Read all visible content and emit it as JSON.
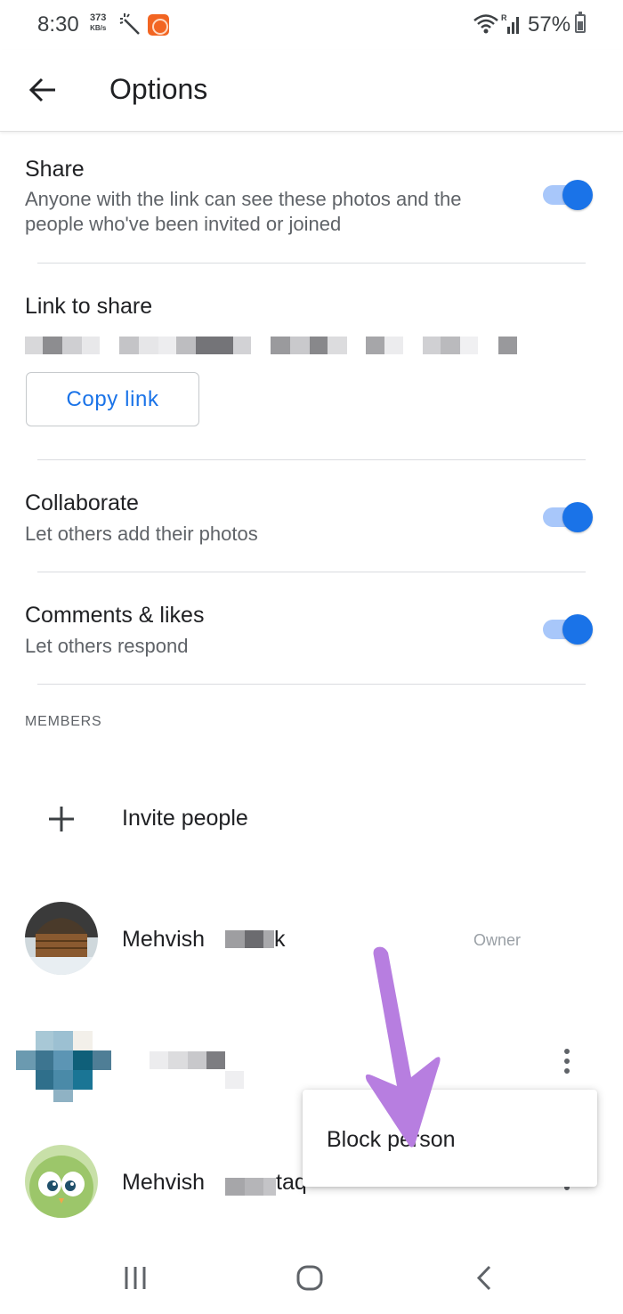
{
  "status_bar": {
    "time": "8:30",
    "speed_value": "373",
    "speed_unit": "KB/s",
    "battery": "57%"
  },
  "app_bar": {
    "title": "Options"
  },
  "share": {
    "title": "Share",
    "description": "Anyone with the link can see these photos and the people who've been invited or joined",
    "enabled": true
  },
  "link": {
    "title": "Link to share",
    "copy_label": "Copy link"
  },
  "collaborate": {
    "title": "Collaborate",
    "description": "Let others add their photos",
    "enabled": true
  },
  "comments": {
    "title": "Comments & likes",
    "description": "Let others respond",
    "enabled": true
  },
  "members": {
    "header": "MEMBERS",
    "invite_label": "Invite people",
    "list": [
      {
        "name_visible": "Mehvish",
        "name_tail": "k",
        "role": "Owner"
      },
      {
        "name_visible": "",
        "role": ""
      },
      {
        "name_visible": "Mehvish",
        "name_tail": "taq",
        "role": ""
      }
    ]
  },
  "popup_menu": {
    "items": [
      "Block person"
    ]
  },
  "colors": {
    "accent": "#1a73e8",
    "toggle_track": "#a8c7fa",
    "annotation": "#b77ee0"
  },
  "icons": [
    "back-arrow-icon",
    "plus-icon",
    "more-vert-icon",
    "wifi-icon",
    "signal-icon",
    "battery-icon",
    "recents-icon",
    "home-icon",
    "nav-back-icon"
  ]
}
